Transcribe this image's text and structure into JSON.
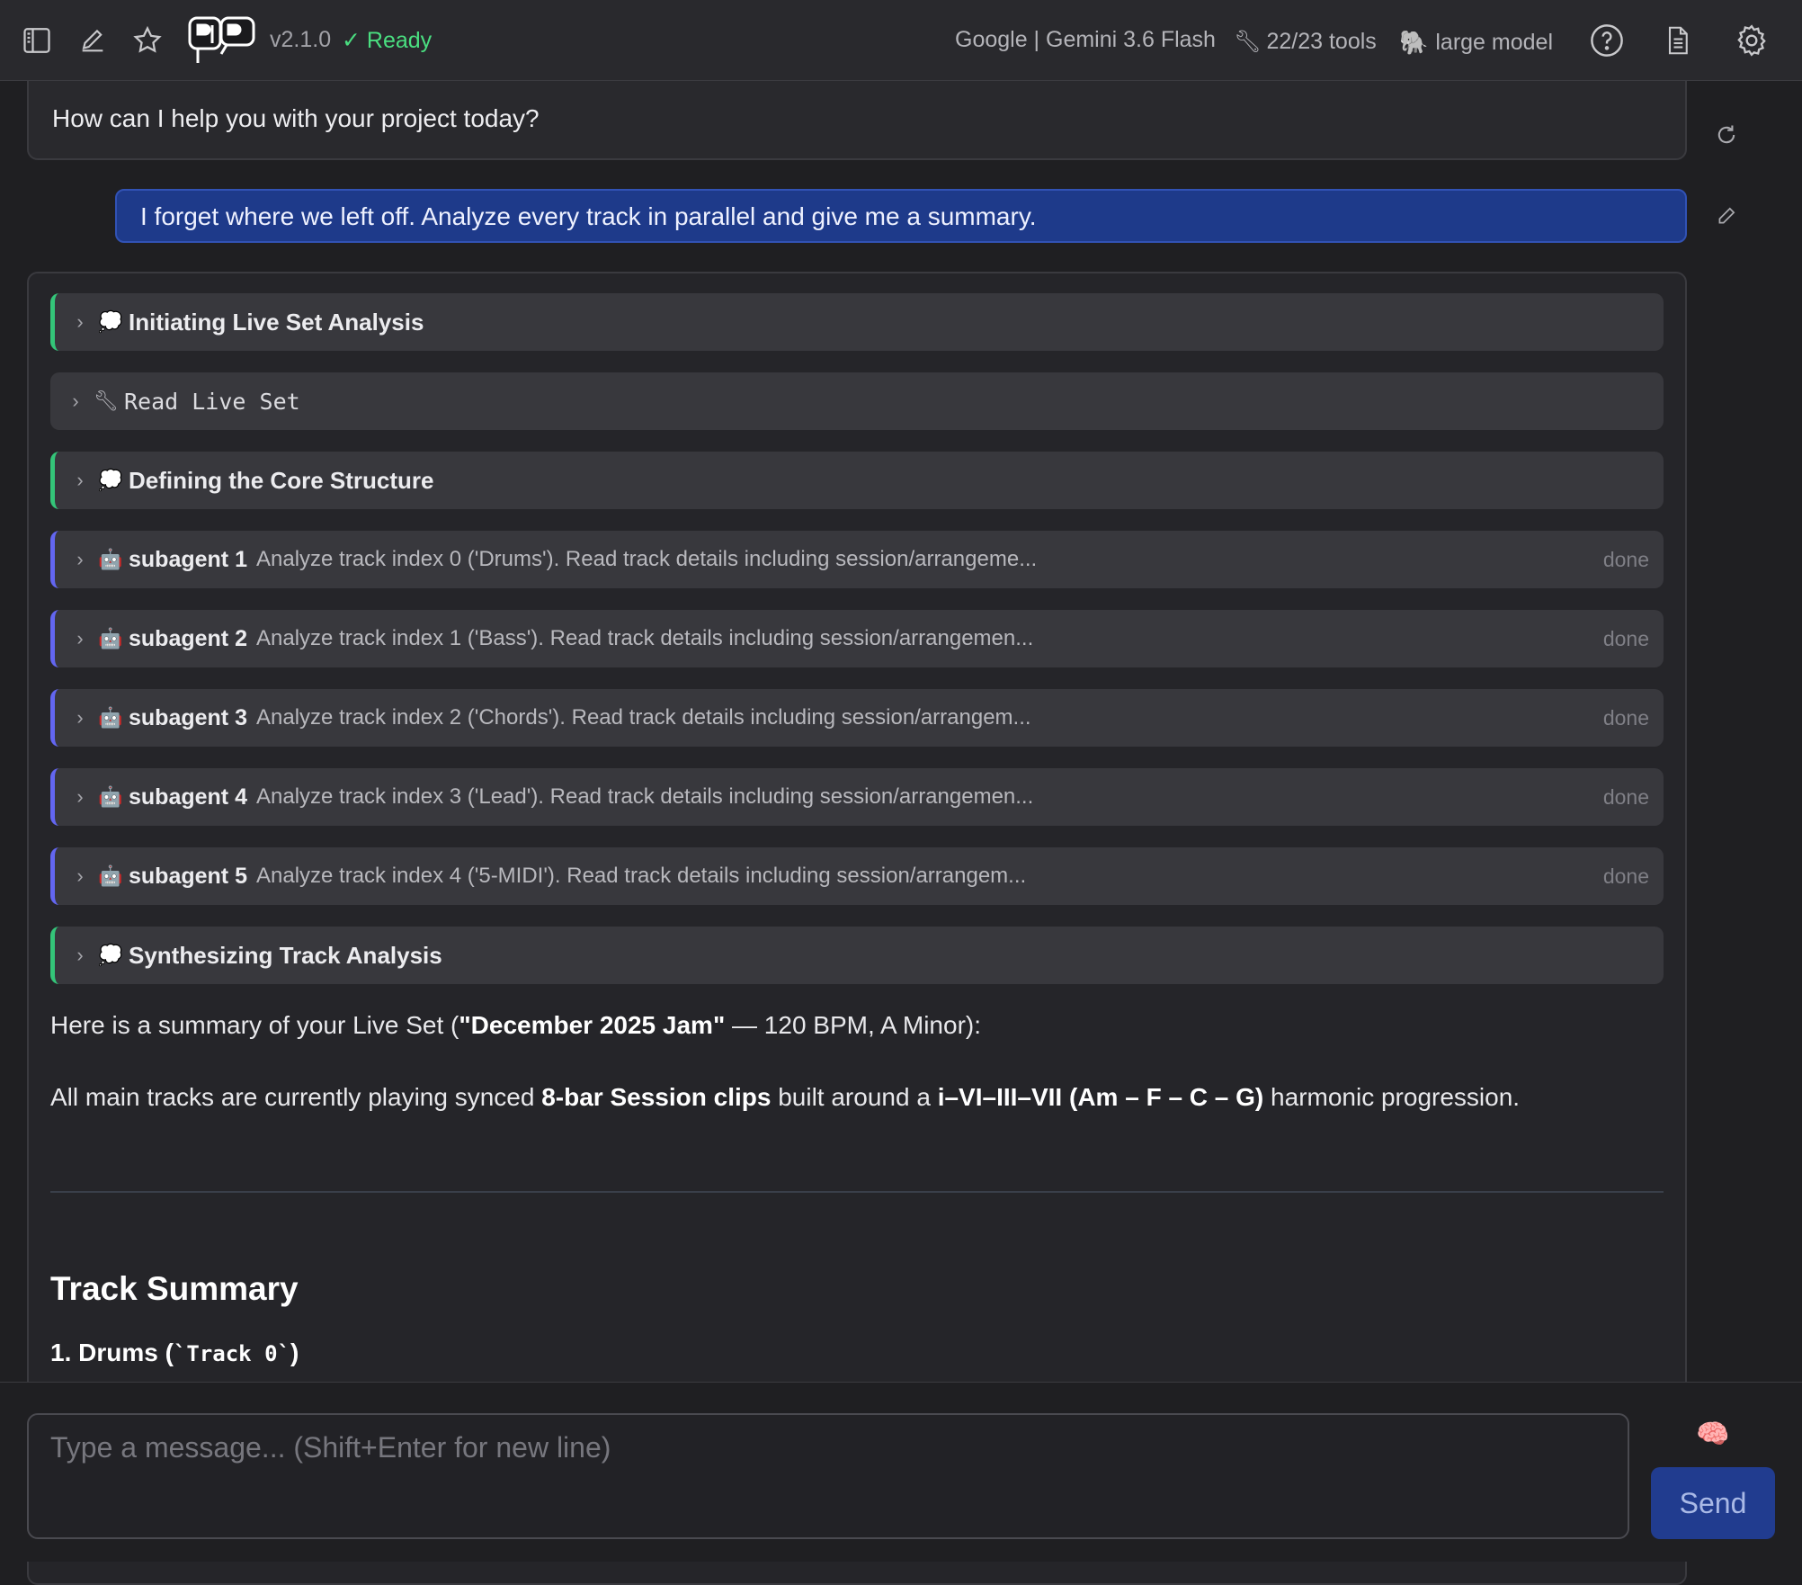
{
  "header": {
    "version": "v2.1.0",
    "status": "✓ Ready",
    "model": "Google | Gemini 3.6 Flash",
    "tools": "22/23 tools",
    "model_size": "large model",
    "status_color": "#4ade80"
  },
  "chat": {
    "assistant_greeting": "How can I help you with your project today?",
    "user_message": "I forget where we left off. Analyze every track in parallel and give me a summary.",
    "steps": [
      {
        "kind": "thought",
        "icon": "thought-bubble-icon",
        "title": "Initiating Live Set Analysis"
      },
      {
        "kind": "tool",
        "icon": "wrench-icon",
        "title": "Read Live Set"
      },
      {
        "kind": "thought",
        "icon": "thought-bubble-icon",
        "title": "Defining the Core Structure"
      },
      {
        "kind": "agent",
        "icon": "robot-icon",
        "label": "subagent 1",
        "desc": "Analyze track index 0 ('Drums'). Read track details including session/arrangeme...",
        "status": "done"
      },
      {
        "kind": "agent",
        "icon": "robot-icon",
        "label": "subagent 2",
        "desc": "Analyze track index 1 ('Bass'). Read track details including session/arrangemen...",
        "status": "done"
      },
      {
        "kind": "agent",
        "icon": "robot-icon",
        "label": "subagent 3",
        "desc": "Analyze track index 2 ('Chords'). Read track details including session/arrangem...",
        "status": "done"
      },
      {
        "kind": "agent",
        "icon": "robot-icon",
        "label": "subagent 4",
        "desc": "Analyze track index 3 ('Lead'). Read track details including session/arrangemen...",
        "status": "done"
      },
      {
        "kind": "agent",
        "icon": "robot-icon",
        "label": "subagent 5",
        "desc": "Analyze track index 4 ('5-MIDI'). Read track details including session/arrangem...",
        "status": "done"
      },
      {
        "kind": "thought",
        "icon": "thought-bubble-icon",
        "title": "Synthesizing Track Analysis"
      }
    ],
    "summary_p1": {
      "a": "Here is a summary of your Live Set (",
      "b": "\"December 2025 Jam\"",
      "c": " — 120 BPM, A Minor):"
    },
    "summary_p2": {
      "a": "All main tracks are currently playing synced ",
      "b": "8-bar Session clips",
      "c": " built around a ",
      "d": "i–VI–III–VII (Am – F – C – G)",
      "e": " harmonic progression."
    },
    "heading": "Track Summary",
    "subheading": {
      "a": "1. Drums (",
      "code": "`Track 0`",
      "b": ")"
    }
  },
  "composer": {
    "placeholder": "Type a message... (Shift+Enter for new line)",
    "send_label": "Send"
  }
}
